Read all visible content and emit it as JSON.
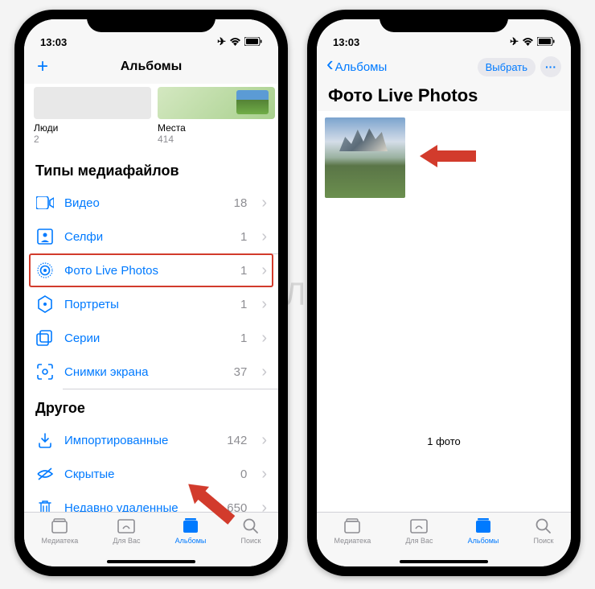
{
  "status": {
    "time": "13:03"
  },
  "left": {
    "nav": {
      "title": "Альбомы"
    },
    "summary": {
      "people_label": "Люди",
      "people_count": "2",
      "places_label": "Места",
      "places_count": "414"
    },
    "sections": {
      "media_header": "Типы медиафайлов",
      "rows": [
        {
          "label": "Видео",
          "count": "18"
        },
        {
          "label": "Селфи",
          "count": "1"
        },
        {
          "label": "Фото Live Photos",
          "count": "1"
        },
        {
          "label": "Портреты",
          "count": "1"
        },
        {
          "label": "Серии",
          "count": "1"
        },
        {
          "label": "Снимки экрана",
          "count": "37"
        }
      ],
      "other_header": "Другое",
      "other_rows": [
        {
          "label": "Импортированные",
          "count": "142"
        },
        {
          "label": "Скрытые",
          "count": "0"
        },
        {
          "label": "Недавно удаленные",
          "count": "650"
        }
      ]
    }
  },
  "right": {
    "nav": {
      "back": "Альбомы",
      "select": "Выбрать"
    },
    "title": "Фото Live Photos",
    "count": "1 фото"
  },
  "tabs": {
    "library": "Медиатека",
    "foryou": "Для Вас",
    "albums": "Альбомы",
    "search": "Поиск"
  },
  "watermark": "ЯБЛЫК"
}
